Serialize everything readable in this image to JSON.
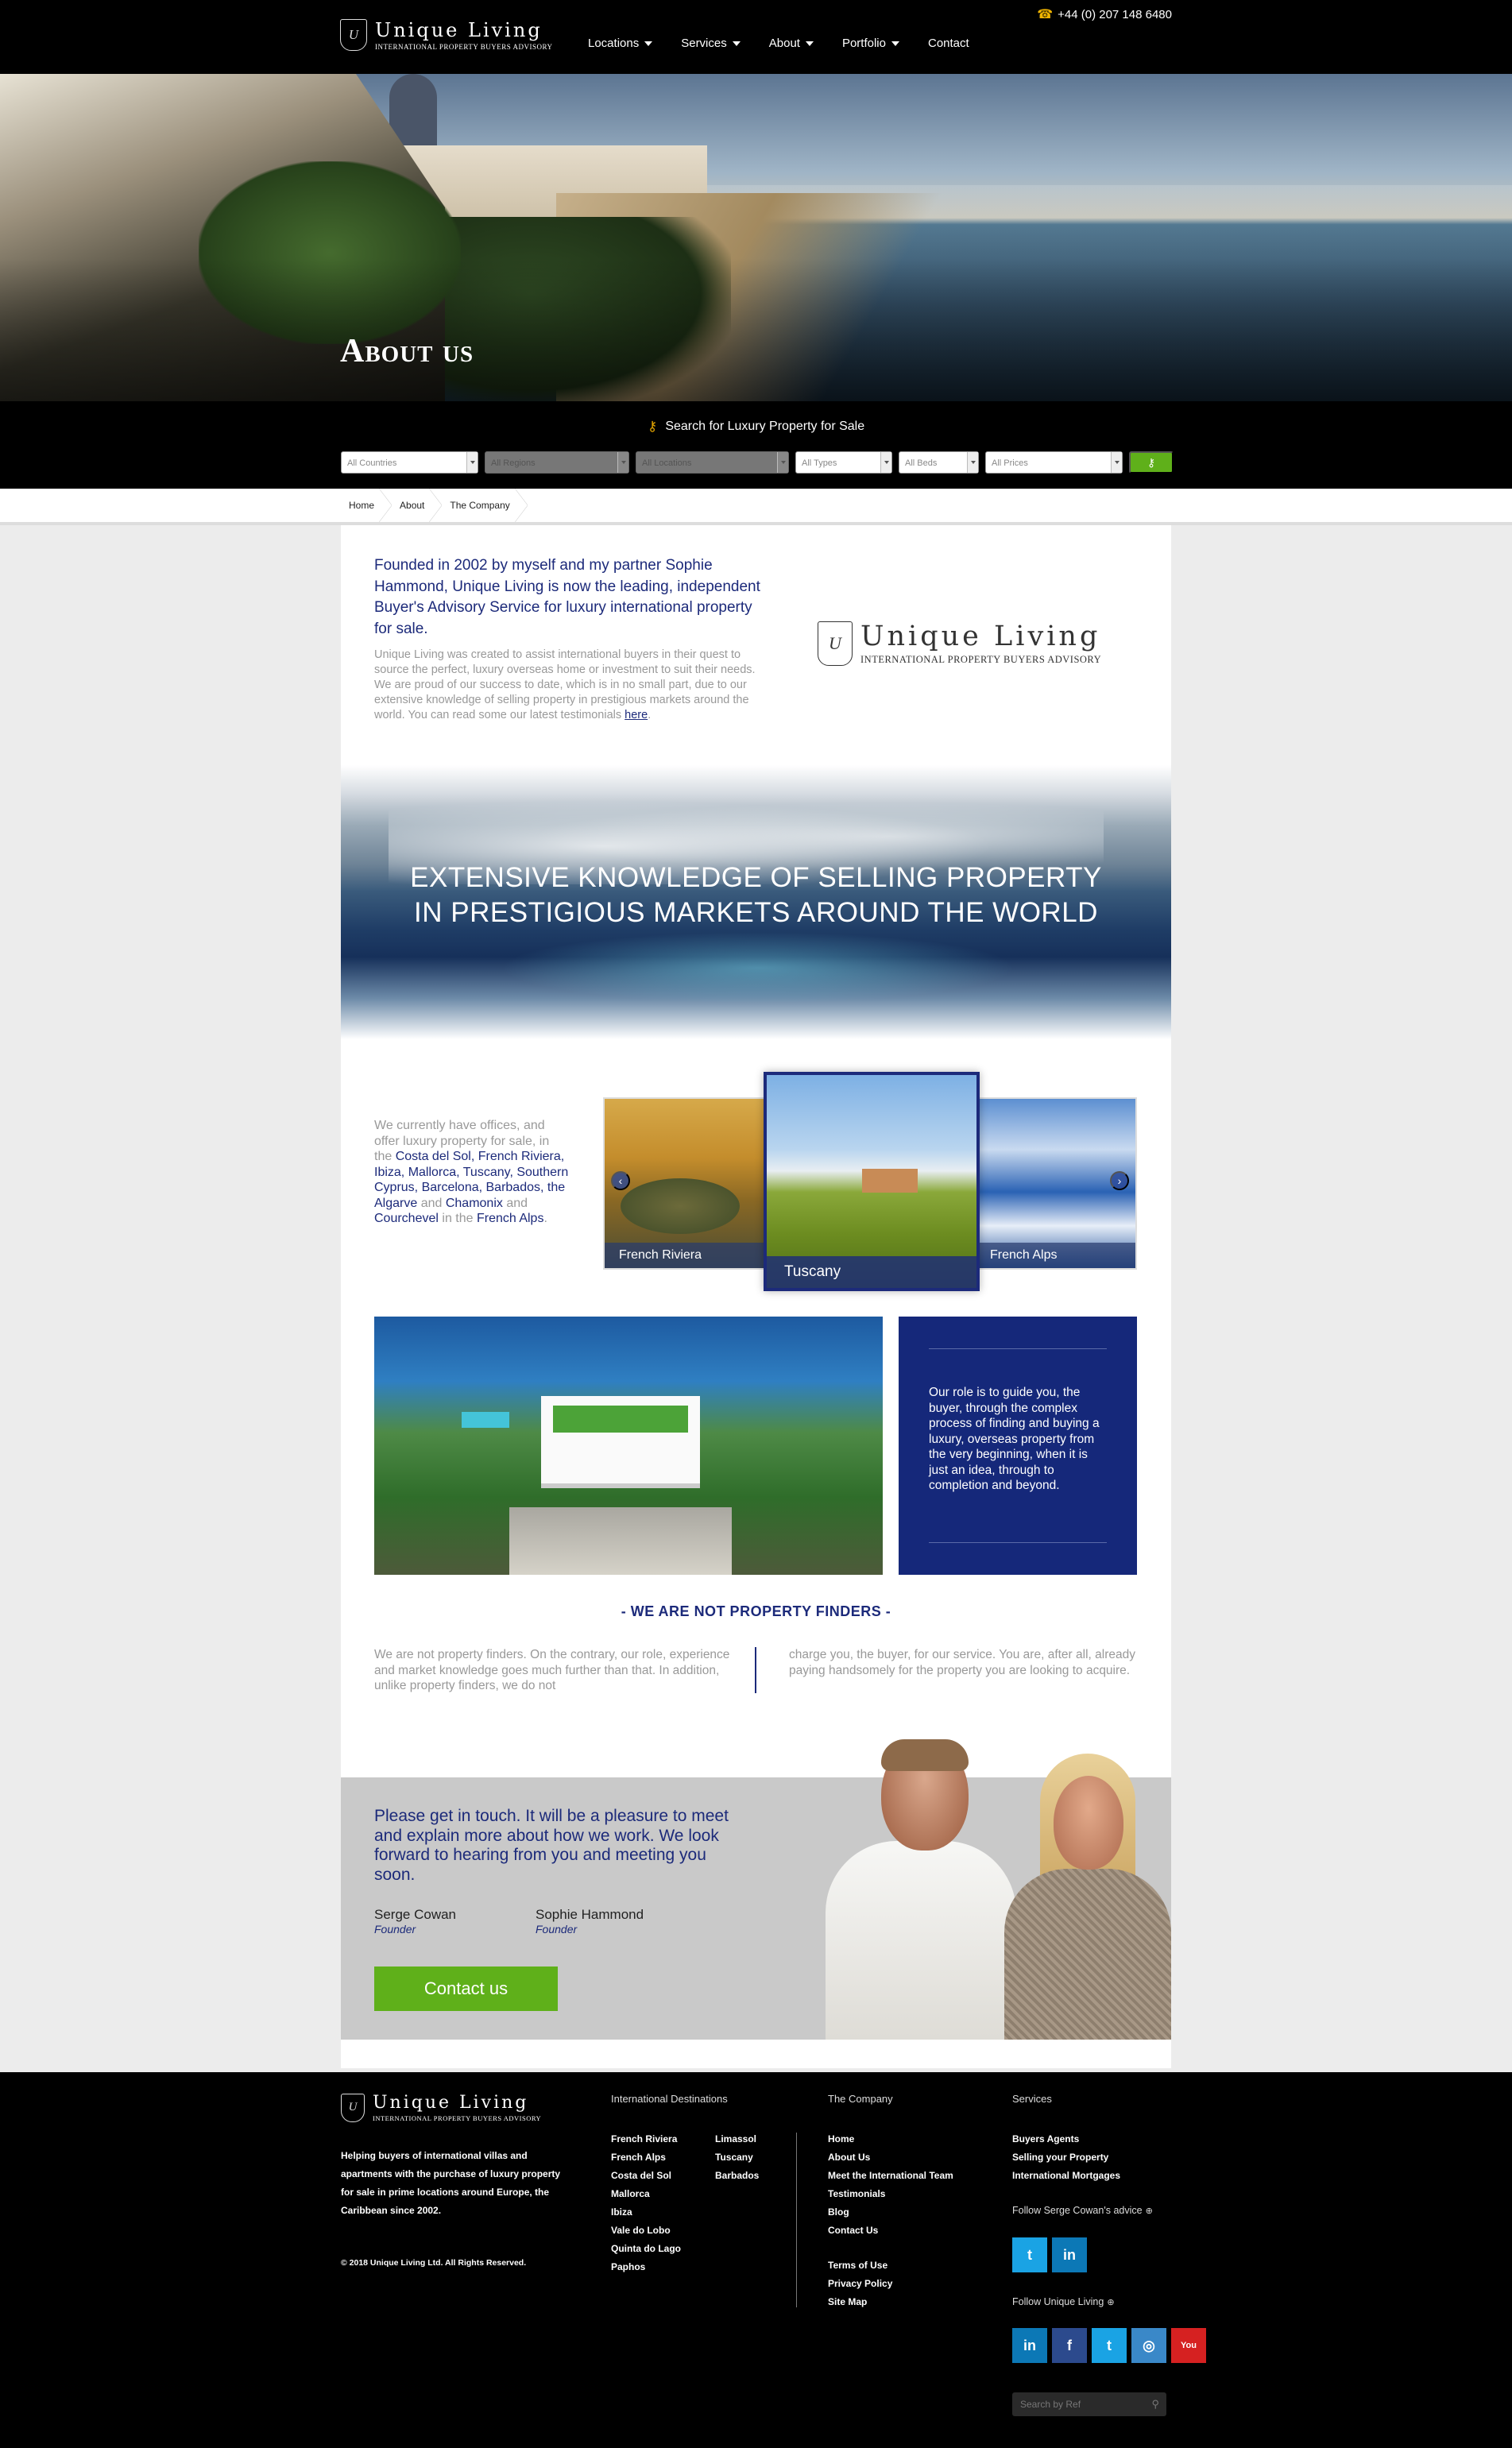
{
  "header": {
    "logo_name": "Unique Living",
    "logo_tagline": "INTERNATIONAL PROPERTY BUYERS ADVISORY",
    "phone": "+44 (0) 207 148 6480",
    "nav": [
      {
        "label": "Locations"
      },
      {
        "label": "Services"
      },
      {
        "label": "About"
      },
      {
        "label": "Portfolio"
      },
      {
        "label": "Contact"
      }
    ]
  },
  "hero": {
    "title": "About us"
  },
  "search": {
    "heading": "Search for Luxury Property for Sale",
    "filters": [
      "All Countries",
      "All Regions",
      "All Locations",
      "All Types",
      "All Beds",
      "All Prices"
    ]
  },
  "breadcrumb": [
    "Home",
    "About",
    "The Company"
  ],
  "intro": {
    "lead": "Founded in 2002 by myself and my partner Sophie Hammond, Unique Living is now the leading, independent Buyer's Advisory Service for luxury international property for sale.",
    "body": "Unique Living was created to assist international buyers in their quest to source the perfect, luxury overseas home or investment to suit their needs.  We are proud of our success to date, which is in no small part, due to our extensive knowledge of selling property in prestigious markets around the world. You can read some our latest testimonials ",
    "link": "here",
    "end": "."
  },
  "banner": {
    "line1": "EXTENSIVE KNOWLEDGE OF SELLING PROPERTY",
    "line2": "IN PRESTIGIOUS MARKETS AROUND THE WORLD"
  },
  "offices": {
    "t1": "We currently have offices, and offer luxury property for sale, in the ",
    "hl1": "Costa del Sol, French Riviera, Ibiza, Mallorca, Tuscany, Southern Cyprus, Barcelona, Barbados, the Algarve",
    "t2": " and ",
    "hl2": "Chamonix",
    "t3": " and ",
    "hl3": "Courchevel",
    "t4": " in the ",
    "hl4": "French Alps",
    "t5": "."
  },
  "carousel": [
    "French Riviera",
    "Tuscany",
    "French Alps"
  ],
  "role": "Our role is to guide you, the buyer, through the complex process of finding and buying a luxury, overseas property from the very beginning, when it is just an idea, through to completion and beyond.",
  "finders": {
    "title": "- WE ARE NOT PROPERTY FINDERS -",
    "left": "We are not property finders.  On the contrary, our role, experience and market knowledge goes much further than that.  In addition, unlike property finders, we do not",
    "right": "charge you, the buyer, for our service.  You are, after all, already paying handsomely for the property you are looking to acquire."
  },
  "contact": {
    "lead": "Please get in touch. It will be a pleasure to meet and explain more about how we work. We look forward to hearing from you and meeting you soon.",
    "founders": [
      {
        "name": "Serge Cowan",
        "role": "Founder"
      },
      {
        "name": "Sophie Hammond",
        "role": "Founder"
      }
    ],
    "button": "Contact us"
  },
  "footer": {
    "about": "Helping buyers of international villas and apartments with the purchase of luxury property for sale in prime locations around Europe, the Caribbean since 2002.",
    "copyright": "© 2018 Unique Living Ltd. All Rights Reserved.",
    "destinations_title": "International Destinations",
    "destinations_1": [
      "French Riviera",
      "French Alps",
      "Costa del Sol",
      "Mallorca",
      "Ibiza",
      "Vale do Lobo",
      "Quinta do Lago",
      "Paphos"
    ],
    "destinations_2": [
      "Limassol",
      "Tuscany",
      "Barbados"
    ],
    "company_title": "The Company",
    "company": [
      "Home",
      "About Us",
      "Meet the International Team",
      "Testimonials",
      "Blog",
      "Contact Us"
    ],
    "company_legal": [
      "Terms of Use",
      "Privacy Policy",
      "Site Map"
    ],
    "services_title": "Services",
    "services": [
      "Buyers Agents",
      "Selling your Property",
      "International Mortgages"
    ],
    "follow_serge": "Follow Serge Cowan's advice",
    "follow_ul": "Follow Unique Living",
    "search_placeholder": "Search by Ref"
  },
  "colors": {
    "navy": "#1c2a7a",
    "green": "#5fb01a",
    "black": "#000000"
  }
}
